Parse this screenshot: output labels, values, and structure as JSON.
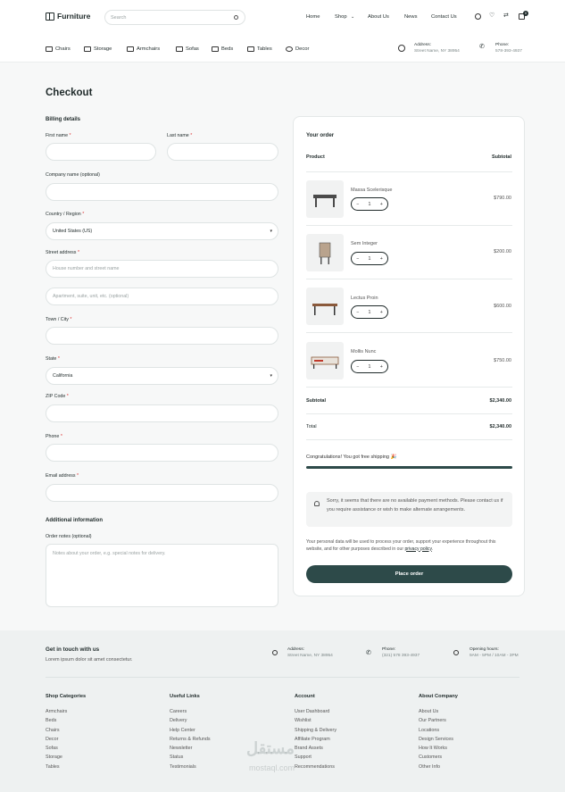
{
  "header": {
    "logo": "Furniture",
    "search_placeholder": "Search",
    "nav": [
      "Home",
      "Shop",
      "About Us",
      "News",
      "Contact Us"
    ],
    "cart_count": "0",
    "categories": [
      "Chairs",
      "Storage",
      "Armchairs",
      "Sofas",
      "Beds",
      "Tables",
      "Decor"
    ],
    "address_label": "Address:",
    "address_value": "Street Name, NY 38954",
    "phone_label": "Phone:",
    "phone_value": "578-393-4937"
  },
  "page_title": "Checkout",
  "billing": {
    "title": "Billing details",
    "first_name": "First name",
    "last_name": "Last name",
    "company": "Company name (optional)",
    "country_label": "Country / Region",
    "country_value": "United States (US)",
    "street_label": "Street address",
    "street_placeholder": "House number and street name",
    "street2_placeholder": "Apartment, suite, unit, etc. (optional)",
    "town": "Town / City",
    "state_label": "State",
    "state_value": "California",
    "zip": "ZIP Code",
    "phone": "Phone",
    "email": "Email address",
    "required": "*"
  },
  "additional": {
    "title": "Additional information",
    "notes_label": "Order notes (optional)",
    "notes_placeholder": "Notes about your order, e.g. special notes for delivery."
  },
  "order": {
    "title": "Your order",
    "col_product": "Product",
    "col_subtotal": "Subtotal",
    "items": [
      {
        "name": "Massa Scelerisque",
        "qty": "1",
        "price": "$790.00"
      },
      {
        "name": "Sem Integer",
        "qty": "1",
        "price": "$200.00"
      },
      {
        "name": "Lectus Proin",
        "qty": "1",
        "price": "$600.00"
      },
      {
        "name": "Mollis Nunc",
        "qty": "1",
        "price": "$750.00"
      }
    ],
    "subtotal_label": "Subtotal",
    "subtotal_value": "$2,340.00",
    "total_label": "Total",
    "total_value": "$2,340.00",
    "shipping_msg": "Congratulations! You got free shipping 🎉",
    "shipping_progress": 1.0,
    "notice": "Sorry, it seems that there are no available payment methods. Please contact us if you require assistance or wish to make alternate arrangements.",
    "privacy_text": "Your personal data will be used to process your order, support your experience throughout this website, and for other purposes described in our",
    "privacy_link": "privacy policy",
    "place_order": "Place order",
    "qty_minus": "−",
    "qty_plus": "+"
  },
  "footer": {
    "title": "Get in touch with us",
    "subtitle": "Lorem ipsum dolor sit amet consectetur.",
    "address_label": "Address:",
    "address_value": "Street Name, NY 38954",
    "phone_label": "Phone:",
    "phone_value": "(321) 578 393-4937",
    "hours_label": "Opening hours:",
    "hours_value": "9AM - 5PM / 10AM - 3PM",
    "columns": [
      {
        "title": "Shop Categories",
        "items": [
          "Armchairs",
          "Beds",
          "Chairs",
          "Decor",
          "Sofas",
          "Storage",
          "Tables"
        ]
      },
      {
        "title": "Useful Links",
        "items": [
          "Careers",
          "Delivery",
          "Help Center",
          "Returns & Refunds",
          "Newsletter",
          "Status",
          "Testimonials"
        ]
      },
      {
        "title": "Account",
        "items": [
          "User Dashboard",
          "Wishlist",
          "Shipping & Delivery",
          "Affiliate Program",
          "Brand Assets",
          "Support",
          "Recommendations"
        ]
      },
      {
        "title": "About Company",
        "items": [
          "About Us",
          "Our Partners",
          "Locations",
          "Design Services",
          "How It Works",
          "Customers",
          "Other Info"
        ]
      }
    ],
    "watermark": "مستقل",
    "watermark_url": "mostaql.com"
  },
  "colors": {
    "accent": "#2d4a49",
    "required": "#dd3333"
  }
}
